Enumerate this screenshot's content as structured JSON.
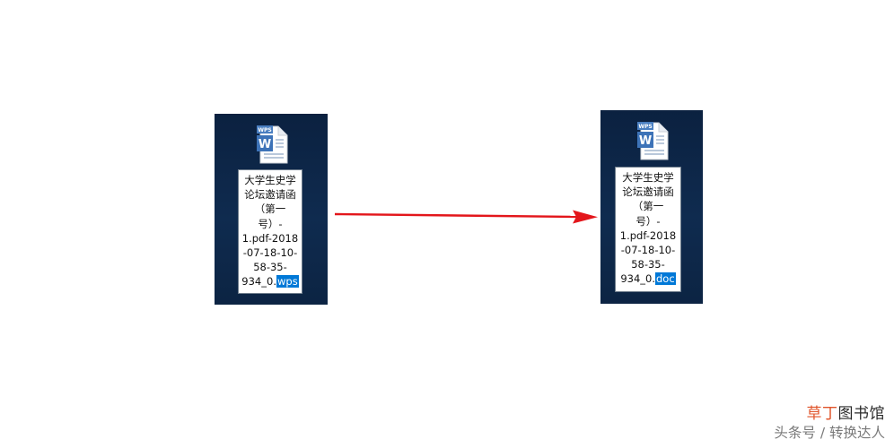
{
  "files": {
    "source": {
      "icon": "wps-writer-document-icon",
      "name_lines": [
        "大学生史学",
        "论坛邀请函",
        "（第一",
        "号）-",
        "1.pdf-2018",
        "-07-18-10-",
        "58-35-"
      ],
      "name_tail_plain": "934_0.",
      "name_tail_selected": "wps"
    },
    "target": {
      "icon": "wps-writer-document-icon",
      "name_lines": [
        "大学生史学",
        "论坛邀请函",
        "（第一",
        "号）-",
        "1.pdf-2018",
        "-07-18-10-",
        "58-35-"
      ],
      "name_tail_plain": "934_0.",
      "name_tail_selected": "doc"
    }
  },
  "arrow": {
    "color": "#e3161b",
    "direction": "right"
  },
  "watermark": {
    "brand_accent": "草丁",
    "brand_rest": "图书馆",
    "source": "头条号 / 转换达人"
  },
  "colors": {
    "desktop_bg": "#0d2745",
    "selection": "#0078d7",
    "wps_badge": "#4a7fc1",
    "accent": "#e0552b"
  }
}
